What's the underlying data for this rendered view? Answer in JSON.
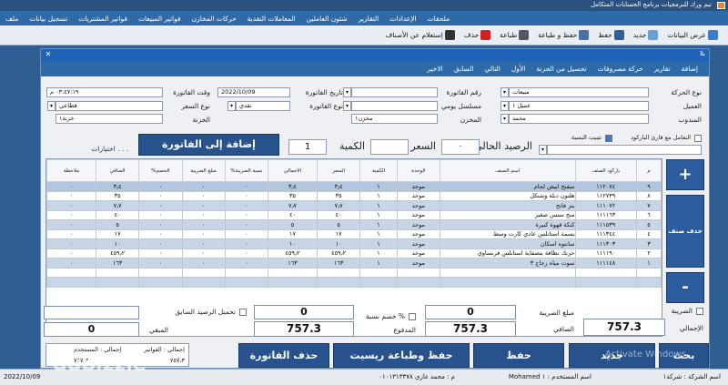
{
  "window": {
    "title": "تيم ورك للبرمجيات برنامج الحسابات المتكامل"
  },
  "menu": [
    "ملف",
    "تسجيل بيانات",
    "فواتير المشتريات",
    "فواتير المبيعات",
    "حركات المخازن",
    "المعاملات النقدية",
    "شئون العاملين",
    "التقارير",
    "الإعدادات",
    "ملحقات"
  ],
  "toolbar": [
    {
      "label": "عرض البيانات",
      "icon": "view-icon",
      "color": "#3b7bc8"
    },
    {
      "label": "جديد",
      "icon": "new-icon",
      "color": "#6aa0d8"
    },
    {
      "label": "حفظ",
      "icon": "save-icon",
      "color": "#2f5f9a"
    },
    {
      "label": "حفظ و طباعة",
      "icon": "save-print-icon",
      "color": "#4a6fa0"
    },
    {
      "label": "طباعة",
      "icon": "print-icon",
      "color": "#556"
    },
    {
      "label": "حذف",
      "icon": "delete-icon",
      "color": "#d02020"
    },
    {
      "label": "إستعلام عن الأصناف",
      "icon": "query-icon",
      "color": "#333"
    }
  ],
  "form_title": "بلا",
  "tabs": [
    "إضافة",
    "تقارير",
    "حركة مصروفات",
    "تحصيل من الحزنة",
    "الأول",
    "التالي",
    "السابق",
    "الاخير"
  ],
  "header": {
    "movement_type_label": "نوع الحركة",
    "movement_type": "مبيعات",
    "invoice_no_label": "رقم الفاتورة",
    "invoice_no": "",
    "invoice_date_label": "تاريخ الفاتورة",
    "invoice_date": "2022/10/09",
    "invoice_time_label": "وقت الفاتورة",
    "invoice_time": "٠٣:٤٧:١٩ م",
    "customer_label": "العميل",
    "customer": "عميل ١",
    "daily_serial_label": "مسلسل يومي",
    "daily_serial": "",
    "invoice_type_label": "نوع الفاتورة",
    "invoice_type": "نقدي",
    "price_type_label": "نوع السعر",
    "price_type": "قطاعي",
    "rep_label": "المندوب",
    "rep": "محمد",
    "store_label": "المخزن",
    "store": "مخزن١",
    "treasury_label": "الخزنة",
    "treasury": "خزنة١"
  },
  "entry": {
    "barcode_check": "التعامل مع قارئ الباركود",
    "fixed_percent_check": "تثبيت النسبة",
    "balance_label": "الرصيد الحالي",
    "balance": "٠",
    "price_label": "السعر",
    "price": "",
    "qty_label": "الكمية",
    "qty": "1",
    "add_button": "إضافة إلى الفاتورة",
    "options_link": "اختيارات . . ."
  },
  "grid": {
    "columns": [
      "م",
      "باركود الصنف",
      "اسم الصنف",
      "الوحدة",
      "الكمية",
      "السعر",
      "الاجمالي",
      "نسبة الضريبة%",
      "مبلغ الضريبة",
      "الخصم%",
      "الصافي",
      "ملاحظة"
    ],
    "rows": [
      [
        "٩",
        "١١٢٠٧٤",
        "سفنج ابيض لحام",
        "موحد",
        "١",
        "٣٫٤",
        "٣٫٤",
        "٠",
        "٠",
        "٠",
        "٣٫٤",
        "٠"
      ],
      [
        "٨",
        "١١٢٧٣٩",
        "هلتون دبلة وشنكل",
        "موحد",
        "١",
        "٣٥",
        "٣٥",
        "٠",
        "٠",
        "٠",
        "٣٥",
        "٠"
      ],
      [
        "٧",
        "١١١٠٧٢",
        "بنز فاتح",
        "موحد",
        "١",
        "٧٫٧",
        "٧٫٧",
        "٠",
        "٠",
        "٠",
        "٧٫٧",
        "٠"
      ],
      [
        "٦",
        "١١١١٦٣",
        "منج سنس صغير",
        "موحد",
        "١",
        "٤٠",
        "٤٠",
        "٠",
        "٠",
        "٠",
        "٤٠",
        "٠"
      ],
      [
        "٥",
        "١١١٥٣٩",
        "كنكة قهوة كبيرة",
        "موحد",
        "١",
        "٥",
        "٥",
        "٠",
        "٠",
        "٠",
        "٥",
        "٠"
      ],
      [
        "٤",
        "١١١٣٤٤",
        "بسمة استانلس عادي كارت وسط",
        "موحد",
        "١",
        "١٧",
        "١٧",
        "٠",
        "٠",
        "٠",
        "١٧",
        "٠"
      ],
      [
        "٣",
        "١١١٣٠٣",
        "سانتوه اسكان",
        "موحد",
        "١",
        "١٠",
        "١٠",
        "٠",
        "٠",
        "٠",
        "١٠",
        "٠"
      ],
      [
        "٢",
        "١١١١٩٠",
        "حرنك نظافة بتصفاية استانلس فرنساوي",
        "موحد",
        "١",
        "٤٥٩٫٢",
        "٤٥٩٫٢",
        "٠",
        "٠",
        "٠",
        "٤٥٩٫٢",
        "٠"
      ],
      [
        "١",
        "١١١١٤٨",
        "سوت مياه زجاج ٣",
        "موحد",
        "١",
        "١٦٣",
        "١٦٣",
        "٠",
        "٠",
        "٠",
        "١٦٣",
        "٠"
      ],
      [
        "",
        "",
        "",
        "",
        "",
        "",
        "",
        "",
        "",
        "",
        "",
        ""
      ],
      [
        "",
        "",
        "",
        "",
        "",
        "",
        "",
        "",
        "",
        "",
        "",
        ""
      ]
    ]
  },
  "side_buttons": {
    "plus": "+",
    "delete_item": "حذف صنف",
    "minus": "-"
  },
  "totals": {
    "tax_label": "الضريبة",
    "total_label": "الإجمالي",
    "total": "757.3",
    "tax_amount_label": "مبلغ الضريبة",
    "tax_amount": "0",
    "net_label": "الصافي",
    "net": "757.3",
    "discount_percent_label": "خصم نسبة %",
    "discount_value": "0",
    "paid_label": "المدفوع",
    "paid": "757.3",
    "prev_balance_label": "تحميل الرصيد السابق",
    "prev_balance": "",
    "remaining_label": "المبقي",
    "remaining": "0"
  },
  "invoices_box": {
    "label1": "إجمالي : الفواتير",
    "value1": "٧٥٧٫٣",
    "label2": "إجمالي : المستخدم",
    "value2": "٧٥٧٫٣"
  },
  "actions": {
    "new": "جديد",
    "save": "حفظ",
    "save_receipt": "حفظ وطباعة ريسيت",
    "delete_invoice": "حذف الفاتورة",
    "search": "بحث"
  },
  "watermark": "Activate Windows",
  "status": {
    "company": "اسم الشركة : شركة١",
    "user": "اسم المستخدم : ١ Mohamed",
    "dev": "م : محمد غازي ٠١٠١٣١٣٣٧٨",
    "date": "2022/10/09"
  },
  "logo_text": "dubizzle"
}
